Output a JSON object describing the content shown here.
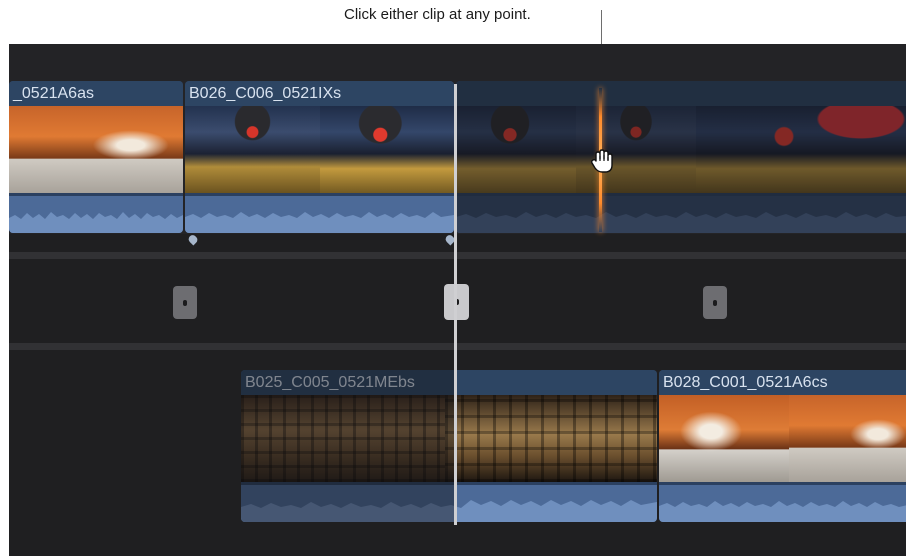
{
  "callout": {
    "text": "Click either clip at any point."
  },
  "storyline_clips": [
    {
      "title": "_0521A6as"
    },
    {
      "title": "B026_C006_0521IXs"
    },
    {
      "title": ""
    }
  ],
  "connected_clips": [
    {
      "title": "B025_C005_0521MEbs"
    },
    {
      "title": "B028_C001_0521A6cs"
    }
  ],
  "icons": {
    "cursor": "hand-grab-icon",
    "playhead": "playhead-line",
    "skimmer": "skimmer-line"
  },
  "colors": {
    "timeline_bg": "#1f1f21",
    "clip_header": "#2d4563",
    "audio_waveform": "#4c6a98",
    "skimmer": "#ff8a2a",
    "playhead": "#cfcfd2"
  }
}
